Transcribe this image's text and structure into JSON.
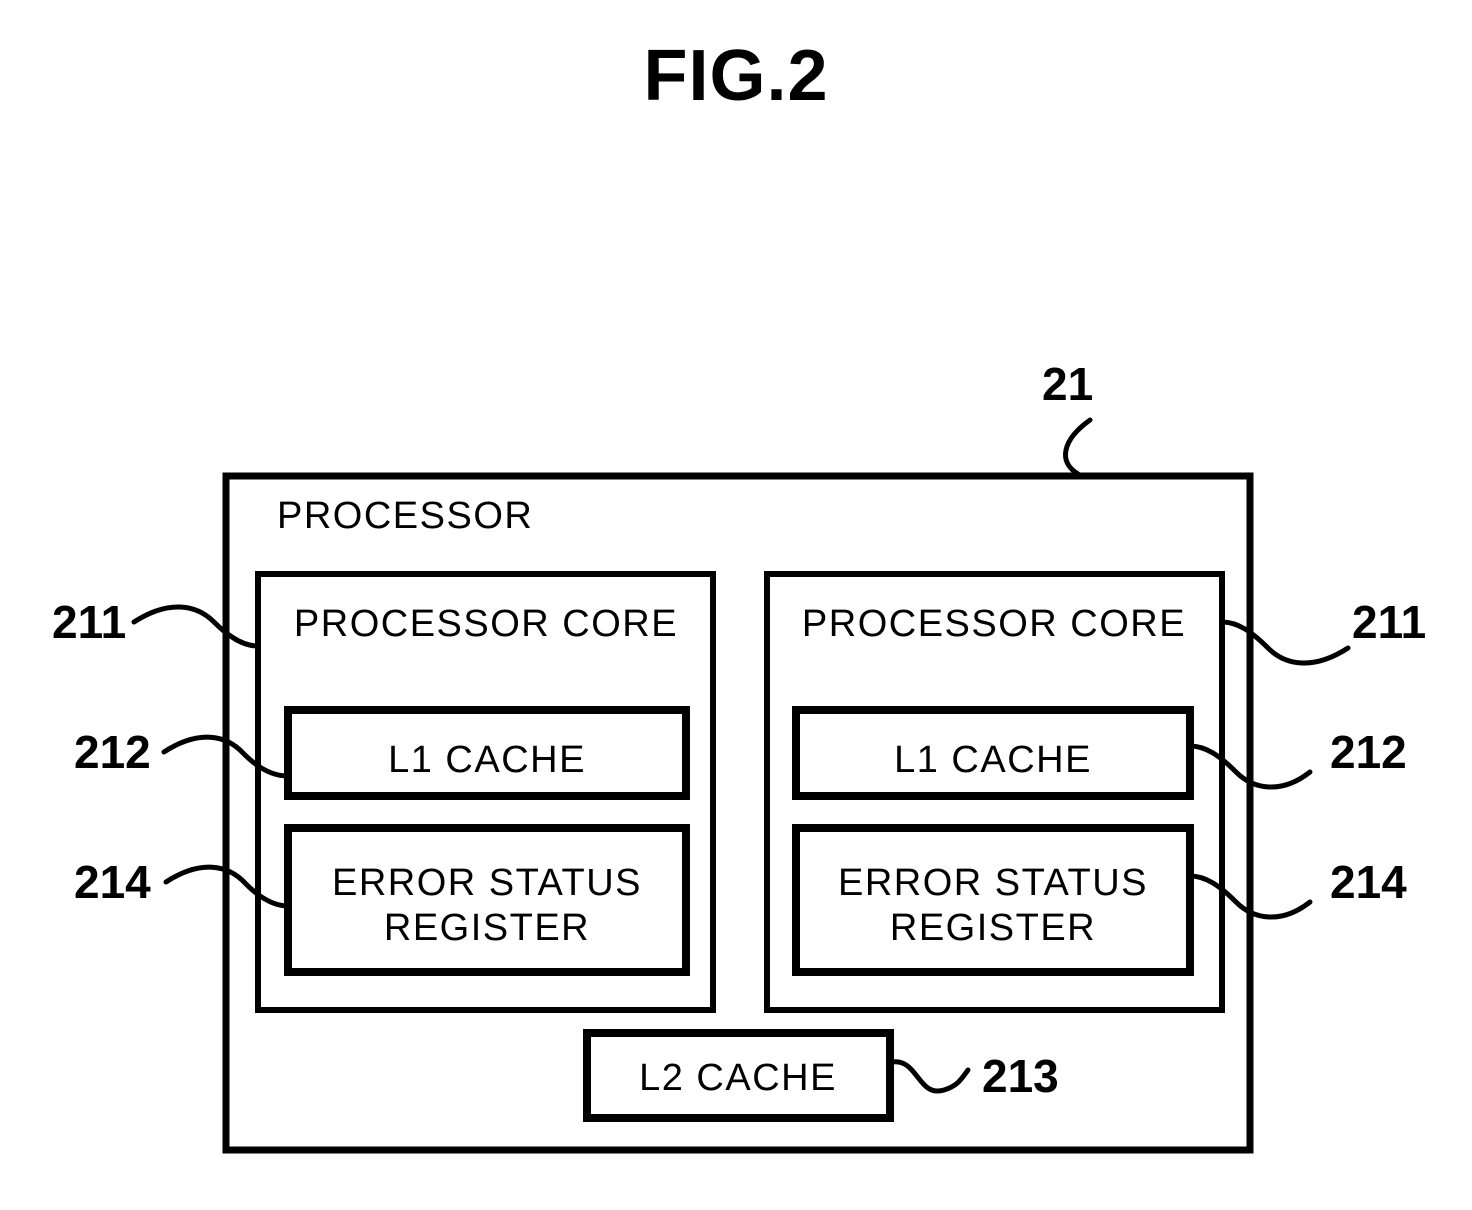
{
  "figure": {
    "title": "FIG.2"
  },
  "diagram": {
    "outer": {
      "label": "PROCESSOR",
      "ref": "21"
    },
    "cores": [
      {
        "label": "PROCESSOR CORE",
        "ref": "211",
        "side": "left",
        "blocks": [
          {
            "label": "L1 CACHE",
            "ref": "212"
          },
          {
            "label_line1": "ERROR STATUS",
            "label_line2": "REGISTER",
            "ref": "214"
          }
        ]
      },
      {
        "label": "PROCESSOR CORE",
        "ref": "211",
        "side": "right",
        "blocks": [
          {
            "label": "L1 CACHE",
            "ref": "212"
          },
          {
            "label_line1": "ERROR STATUS",
            "label_line2": "REGISTER",
            "ref": "214"
          }
        ]
      }
    ],
    "shared": {
      "l2": {
        "label": "L2 CACHE",
        "ref": "213"
      }
    }
  },
  "colors": {
    "ink": "#000000",
    "paper": "#ffffff"
  }
}
